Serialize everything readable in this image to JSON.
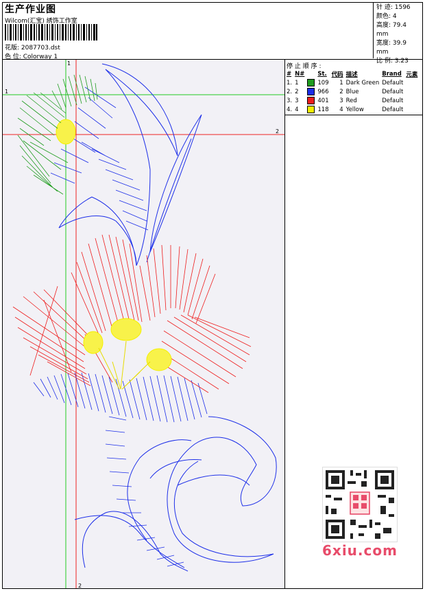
{
  "header": {
    "title": "生产作业图",
    "studio": "Wilcom(汇宝) 綉饰工作室",
    "design_label": "花版: 2087703.dst",
    "colorway_label": "色 位: Colorway 1"
  },
  "stats": {
    "stitches": "针 迹: 1596",
    "colors": "颜色: 4",
    "height": "高度: 79.4 mm",
    "width": "宽度: 39.9 mm",
    "scale": "比 例: 3.23"
  },
  "stop_sequence": {
    "title": "停 止 顺 序 :",
    "headers": [
      "#",
      "N#",
      "St.",
      "代码",
      "描述",
      "Brand",
      "元素"
    ],
    "rows": [
      {
        "idx": "1.",
        "n": "1",
        "color": "#1f9c1f",
        "st": "109",
        "code": "1",
        "desc": "Dark Green",
        "brand": "Default"
      },
      {
        "idx": "2.",
        "n": "2",
        "color": "#1c2ee8",
        "st": "966",
        "code": "2",
        "desc": "Blue",
        "brand": "Default"
      },
      {
        "idx": "3.",
        "n": "3",
        "color": "#ee1c1c",
        "st": "401",
        "code": "3",
        "desc": "Red",
        "brand": "Default"
      },
      {
        "idx": "4.",
        "n": "4",
        "color": "#f4f000",
        "st": "118",
        "code": "4",
        "desc": "Yellow",
        "brand": "Default"
      }
    ]
  },
  "guides": {
    "green_v": "1",
    "green_h": "1",
    "red_h": "2",
    "red_v": "2"
  },
  "watermark": {
    "site": "6xiu.com"
  }
}
